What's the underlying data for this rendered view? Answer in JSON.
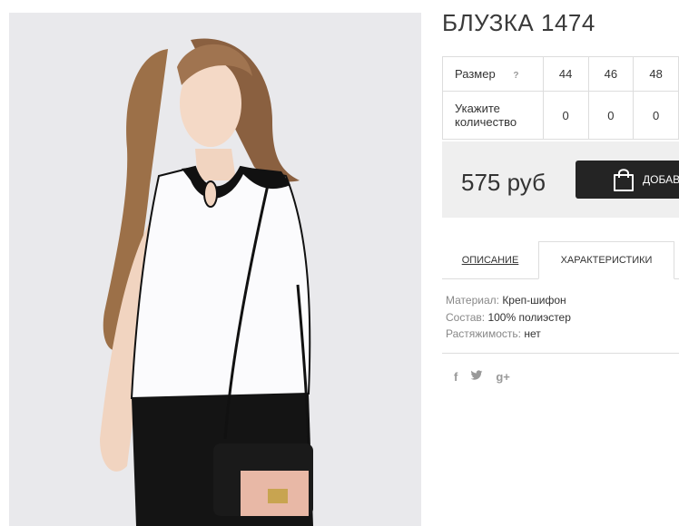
{
  "product": {
    "title": "БЛУЗКА 1474"
  },
  "sizes": {
    "size_label": "Размер",
    "help_icon": "?",
    "values": [
      "44",
      "46",
      "48"
    ],
    "qty_label": "Укажите количество",
    "quantities": [
      "0",
      "0",
      "0"
    ]
  },
  "buy": {
    "price": "575 руб",
    "button_label": "ДОБАВИТЬ"
  },
  "tabs": [
    {
      "label": "ОПИСАНИЕ",
      "active": false
    },
    {
      "label": "ХАРАКТЕРИСТИКИ",
      "active": true
    }
  ],
  "properties": [
    {
      "key": "Материал:",
      "value": "Креп-шифон"
    },
    {
      "key": "Состав:",
      "value": "100% полиэстер"
    },
    {
      "key": "Растяжимость:",
      "value": "нет"
    }
  ],
  "social": {
    "facebook": "f",
    "twitter": "twitter-icon",
    "googleplus": "g+"
  }
}
